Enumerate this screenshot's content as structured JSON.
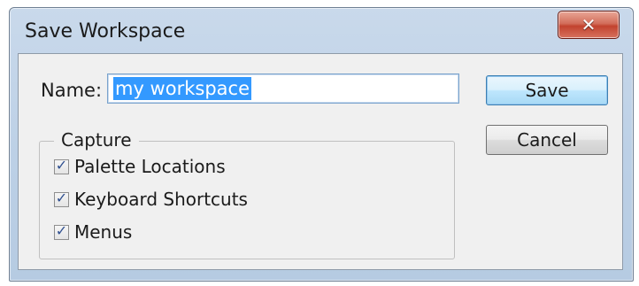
{
  "window": {
    "title": "Save Workspace",
    "close_glyph": "✕"
  },
  "form": {
    "name_label": "Name:",
    "name_value": "my workspace",
    "save_label": "Save",
    "cancel_label": "Cancel"
  },
  "capture": {
    "legend": "Capture",
    "options": [
      {
        "label": "Palette Locations",
        "checked": true
      },
      {
        "label": "Keyboard Shortcuts",
        "checked": true
      },
      {
        "label": "Menus",
        "checked": true
      }
    ],
    "check_glyph": "✓"
  },
  "colors": {
    "selection": "#3399ff",
    "close_button": "#c2432f"
  }
}
